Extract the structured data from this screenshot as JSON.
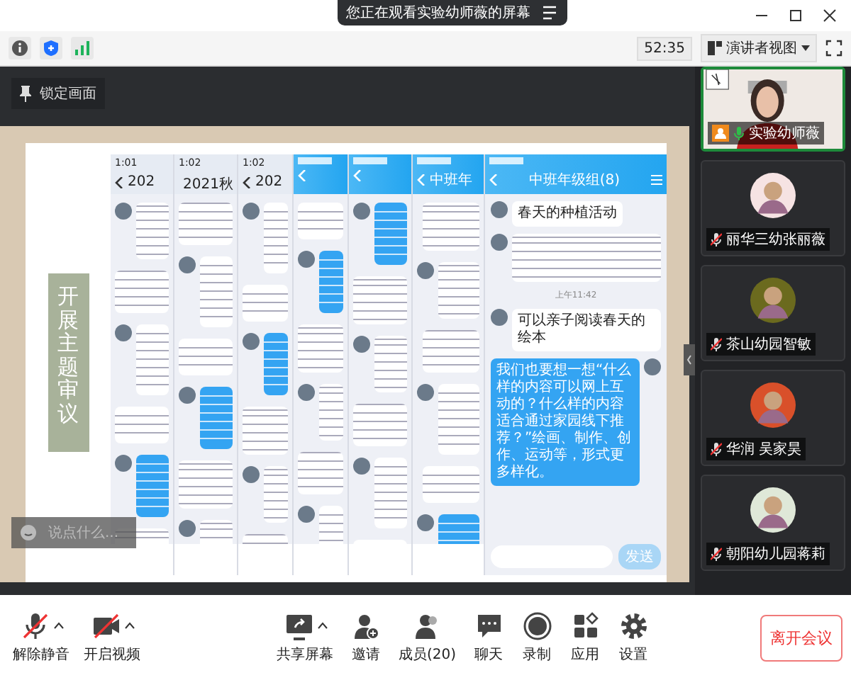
{
  "window": {
    "banner": "您正在观看实验幼师薇的屏幕"
  },
  "toolbar": {
    "timer": "52:35",
    "view_mode": "演讲者视图"
  },
  "share": {
    "lock_label": "锁定画面",
    "chat_placeholder": "说点什么...",
    "slide": {
      "title": "开展主题审议",
      "phones": [
        {
          "kind": "blurred",
          "blue_header": false,
          "time": "1:01",
          "header": "202"
        },
        {
          "kind": "blurred",
          "blue_header": false,
          "time": "1:02",
          "header": "2021秋"
        },
        {
          "kind": "blurred",
          "blue_header": false,
          "time": "1:02",
          "header": "202"
        },
        {
          "kind": "blurred",
          "blue_header": true
        },
        {
          "kind": "blurred",
          "blue_header": true
        },
        {
          "kind": "blurred",
          "blue_header": true,
          "header": "中班年"
        }
      ],
      "chat": {
        "title": "中班年级组(8)",
        "send": "发送",
        "messages": [
          {
            "kind": "text",
            "outgoing": false,
            "text": "春天的种植活动"
          },
          {
            "kind": "blurred",
            "outgoing": false
          },
          {
            "kind": "time",
            "text": "上午11:42"
          },
          {
            "kind": "text",
            "outgoing": false,
            "text": "可以亲子阅读春天的绘本"
          },
          {
            "kind": "text",
            "outgoing": true,
            "text": "我们也要想一想“什么样的内容可以网上互动的？什么样的内容适合通过家园线下推荐？”绘画、制作、创作、运动等，形式更多样化。"
          }
        ]
      }
    }
  },
  "participants": [
    {
      "kind": "video",
      "name": "实验幼师薇",
      "muted": false
    },
    {
      "kind": "avatar",
      "name": "丽华三幼张丽薇",
      "muted": true
    },
    {
      "kind": "avatar",
      "name": "茶山幼园智敏",
      "muted": true
    },
    {
      "kind": "avatar",
      "name": "华润 吴家昊",
      "muted": true
    },
    {
      "kind": "avatar",
      "name": "朝阳幼儿园蒋莉",
      "muted": true
    }
  ],
  "controls_left": [
    {
      "kind": "mic",
      "label": "解除静音",
      "off": true
    },
    {
      "kind": "camera",
      "label": "开启视频",
      "off": true
    }
  ],
  "controls_center": [
    {
      "kind": "share",
      "label": "共享屏幕"
    },
    {
      "kind": "invite",
      "label": "邀请"
    },
    {
      "kind": "members",
      "label": "成员(20)"
    },
    {
      "kind": "chat",
      "label": "聊天"
    },
    {
      "kind": "record",
      "label": "录制"
    },
    {
      "kind": "apps",
      "label": "应用"
    },
    {
      "kind": "settings",
      "label": "设置"
    }
  ],
  "leave": "离开会议"
}
